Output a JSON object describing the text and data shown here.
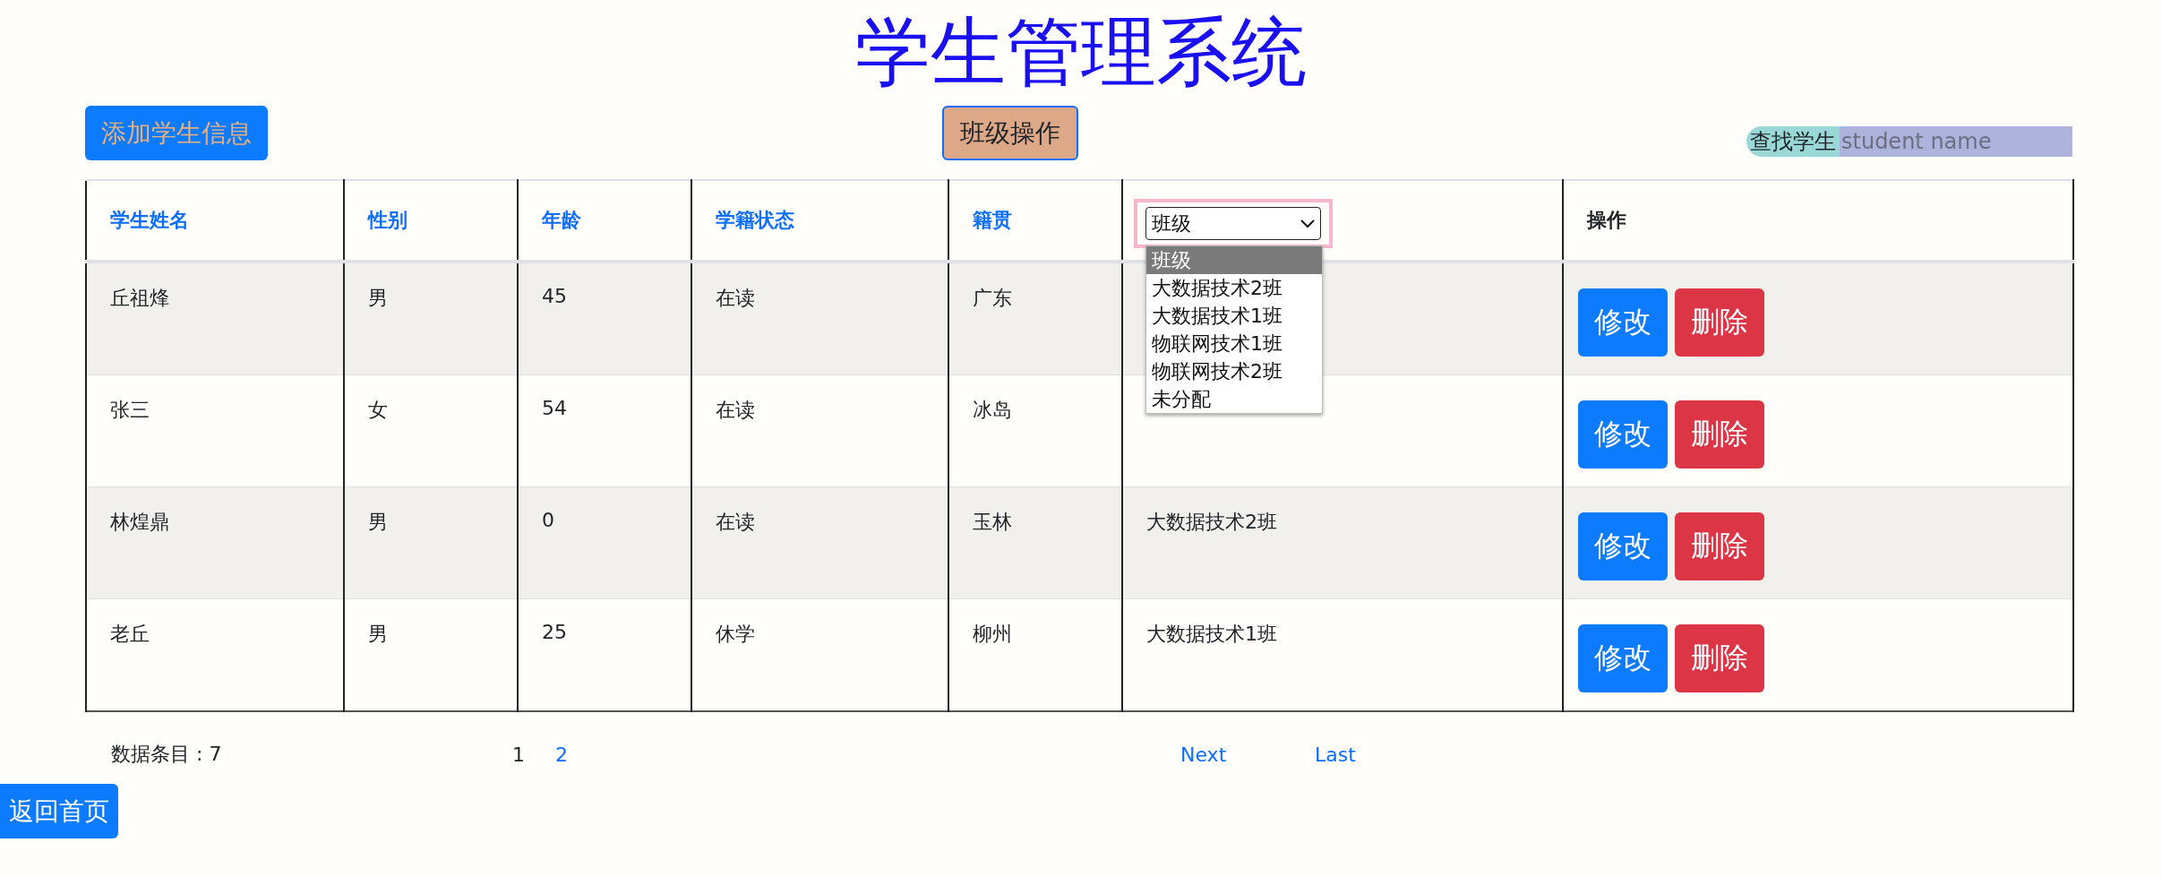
{
  "title": "学生管理系统",
  "toolbar": {
    "add_button": "添加学生信息",
    "class_button": "班级操作",
    "search": {
      "label": "查找学生",
      "placeholder": "student name"
    }
  },
  "table": {
    "columns": [
      "学生姓名",
      "性别",
      "年龄",
      "学籍状态",
      "籍贯"
    ],
    "class_filter": {
      "value": "班级",
      "expanded": true,
      "options": [
        {
          "label": "班级",
          "selected": true
        },
        {
          "label": "大数据技术2班",
          "selected": false
        },
        {
          "label": "大数据技术1班",
          "selected": false
        },
        {
          "label": "物联网技术1班",
          "selected": false
        },
        {
          "label": "物联网技术2班",
          "selected": false
        },
        {
          "label": "未分配",
          "selected": false
        }
      ]
    },
    "action_column": "操作",
    "rows": [
      {
        "cells": [
          "丘祖烽",
          "男",
          "45",
          "在读",
          "广东"
        ],
        "class": "",
        "edit": "修改",
        "delete": "删除"
      },
      {
        "cells": [
          "张三",
          "女",
          "54",
          "在读",
          "冰岛"
        ],
        "class": "",
        "edit": "修改",
        "delete": "删除"
      },
      {
        "cells": [
          "林煌鼎",
          "男",
          "0",
          "在读",
          "玉林"
        ],
        "class": "大数据技术2班",
        "edit": "修改",
        "delete": "删除"
      },
      {
        "cells": [
          "老丘",
          "男",
          "25",
          "休学",
          "柳州"
        ],
        "class": "大数据技术1班",
        "edit": "修改",
        "delete": "删除"
      }
    ]
  },
  "pagination": {
    "count": "数据条目 : 7",
    "pages": [
      {
        "label": "1",
        "selected": true
      },
      {
        "label": "2",
        "selected": false
      }
    ],
    "next": "Next",
    "last": "Last"
  },
  "home_button": "返回首页"
}
